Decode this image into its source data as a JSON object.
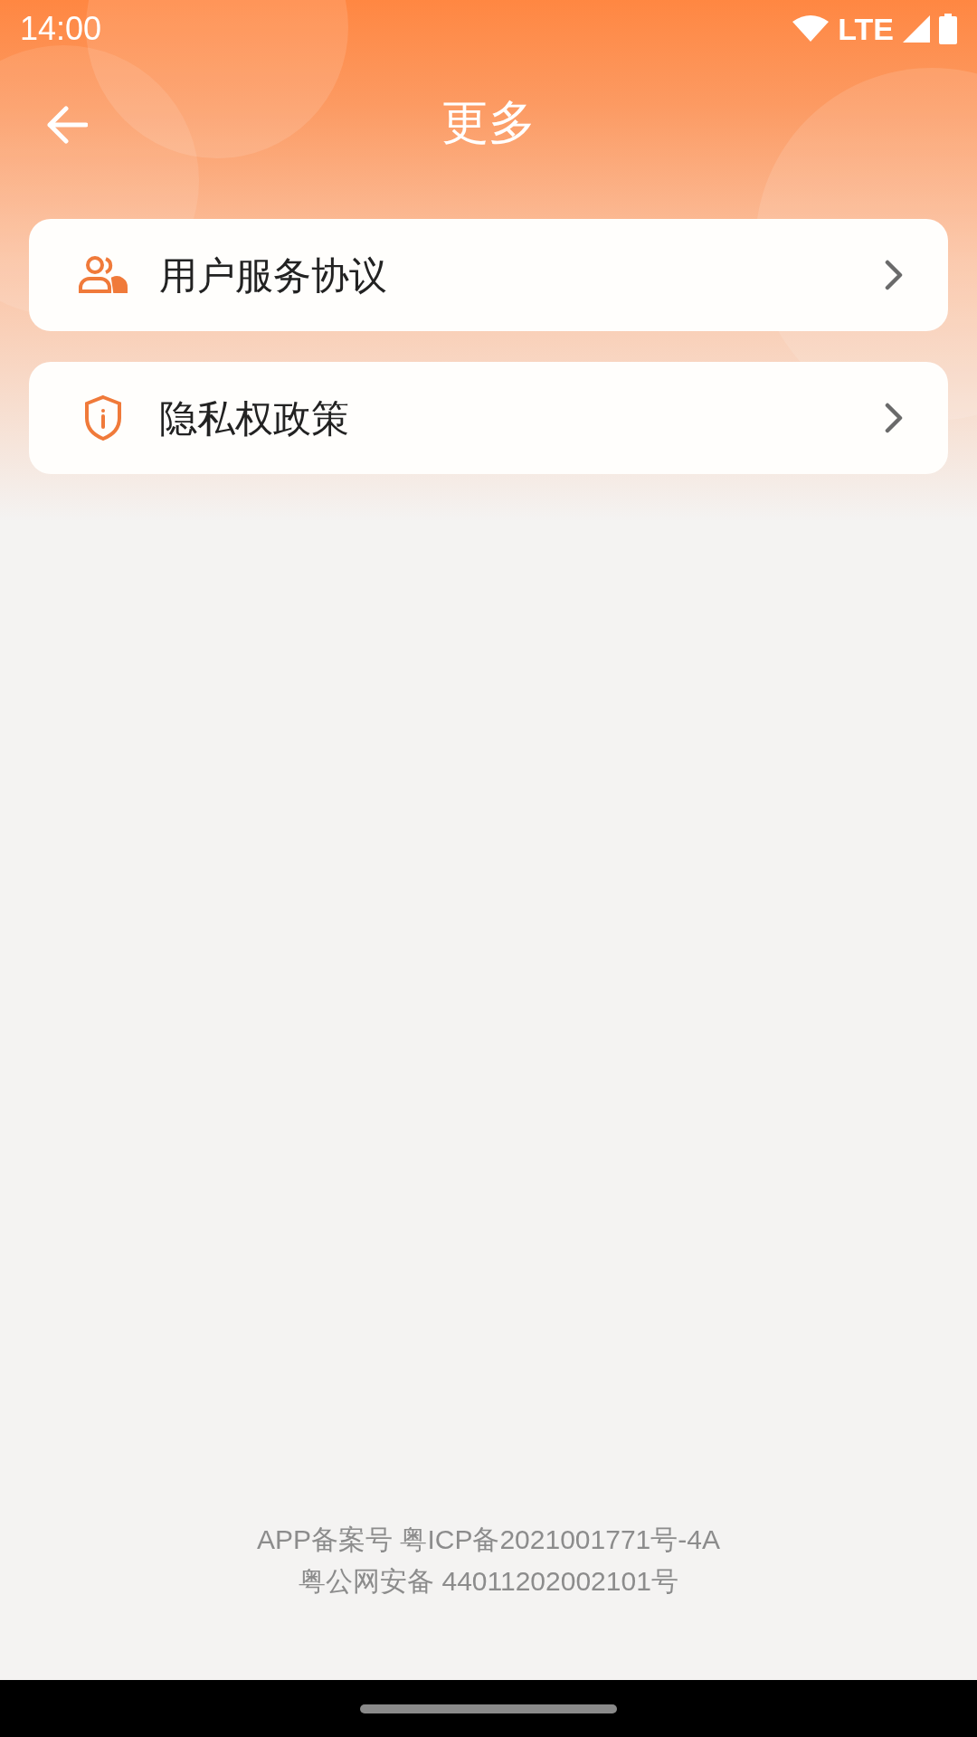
{
  "status_bar": {
    "time": "14:00",
    "network": "LTE"
  },
  "header": {
    "title": "更多"
  },
  "menu_items": [
    {
      "label": "用户服务协议",
      "kind": "people"
    },
    {
      "label": "隐私权政策",
      "kind": "shield"
    }
  ],
  "footer": {
    "lines": [
      "APP备案号 粤ICP备2021001771号-4A",
      "粤公网安备 44011202002101号"
    ]
  }
}
